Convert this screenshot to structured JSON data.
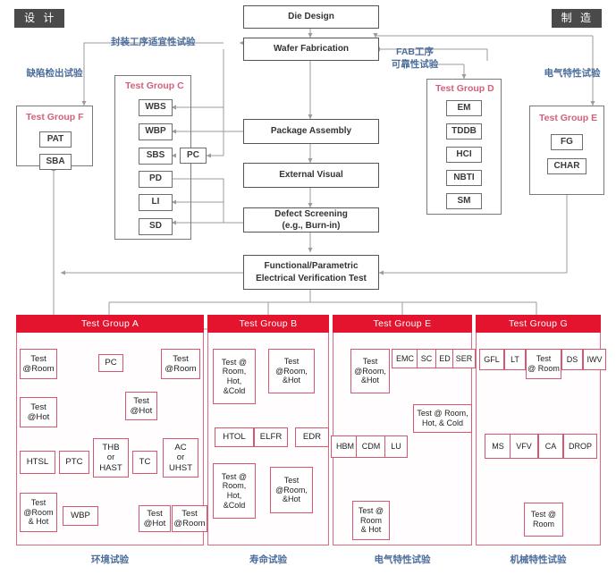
{
  "corner_tags": {
    "left": "设 计",
    "right": "制 造"
  },
  "flow_labels": {
    "package_suitability": "封装工序适宜性试验",
    "defect_detection": "缺陷检出试验",
    "fab_reliability": "FAB工序\n可靠性试验",
    "fab_reliability_line1": "FAB工序",
    "fab_reliability_line2": "可靠性试验",
    "electrical": "电气特性试验"
  },
  "process": {
    "die_design": "Die Design",
    "wafer_fabrication": "Wafer Fabrication",
    "package_assembly": "Package Assembly",
    "external_visual": "External Visual",
    "defect_screening_l1": "Defect Screening",
    "defect_screening_l2": "(e.g., Burn-in)",
    "functional_l1": "Functional/Parametric",
    "functional_l2": "Electrical Verification Test"
  },
  "group_c": {
    "title": "Test Group C",
    "items": [
      "WBS",
      "WBP",
      "SBS",
      "PD",
      "LI",
      "SD"
    ],
    "pc": "PC"
  },
  "group_f": {
    "title": "Test Group F",
    "items": [
      "PAT",
      "SBA"
    ]
  },
  "group_d": {
    "title": "Test Group D",
    "items": [
      "EM",
      "TDDB",
      "HCI",
      "NBTI",
      "SM"
    ]
  },
  "group_e_top": {
    "title": "Test Group E",
    "items": [
      "FG",
      "CHAR"
    ]
  },
  "bottom_groups": [
    {
      "title": "Test Group A",
      "footer": "环境试验",
      "nodes": [
        "Test\n@Room",
        "PC",
        "Test\n@Room",
        "Test\n@Hot",
        "Test\n@Hot",
        "HTSL",
        "PTC",
        "THB\nor\nHAST",
        "TC",
        "AC\nor\nUHST",
        "Test\n@Room\n& Hot",
        "WBP",
        "Test\n@Hot",
        "Test\n@Room"
      ]
    },
    {
      "title": "Test Group B",
      "footer": "寿命试验",
      "nodes": [
        "Test @\nRoom,\nHot,\n&Cold",
        "Test\n@Room,\n&Hot",
        "HTOL",
        "ELFR",
        "EDR",
        "Test @\nRoom,\nHot,\n&Cold",
        "Test\n@Room,\n&Hot"
      ]
    },
    {
      "title": "Test Group E",
      "footer": "电气特性试验",
      "nodes": [
        "Test\n@Room,\n&Hot",
        "EMC",
        "SC",
        "ED",
        "SER",
        "Test @ Room,\nHot, & Cold",
        "HBM",
        "CDM",
        "LU",
        "Test @\nRoom\n& Hot"
      ]
    },
    {
      "title": "Test Group G",
      "footer": "机械特性试验",
      "nodes": [
        "GFL",
        "LT",
        "Test\n@ Room",
        "DS",
        "IWV",
        "MS",
        "VFV",
        "CA",
        "DROP",
        "Test @\nRoom"
      ]
    }
  ],
  "group_a": {
    "title": "Test Group A",
    "footer": "环境试验",
    "test_room_1_l1": "Test",
    "test_room_1_l2": "@Room",
    "pc": "PC",
    "test_room_2_l1": "Test",
    "test_room_2_l2": "@Room",
    "test_hot_1_l1": "Test",
    "test_hot_1_l2": "@Hot",
    "test_hot_2_l1": "Test",
    "test_hot_2_l2": "@Hot",
    "htsl": "HTSL",
    "ptc": "PTC",
    "thb_l1": "THB",
    "thb_l2": "or",
    "thb_l3": "HAST",
    "tc": "TC",
    "ac_l1": "AC",
    "ac_l2": "or",
    "ac_l3": "UHST",
    "room_hot_l1": "Test",
    "room_hot_l2": "@Room",
    "room_hot_l3": "& Hot",
    "wbp": "WBP",
    "test_hot_3_l1": "Test",
    "test_hot_3_l2": "@Hot",
    "test_room_3_l1": "Test",
    "test_room_3_l2": "@Room"
  },
  "group_b": {
    "title": "Test Group B",
    "footer": "寿命试验",
    "n1_l1": "Test @",
    "n1_l2": "Room,",
    "n1_l3": "Hot,",
    "n1_l4": "&Cold",
    "n2_l1": "Test",
    "n2_l2": "@Room,",
    "n2_l3": "&Hot",
    "htol": "HTOL",
    "elfr": "ELFR",
    "edr": "EDR",
    "n3_l1": "Test @",
    "n3_l2": "Room,",
    "n3_l3": "Hot,",
    "n3_l4": "&Cold",
    "n4_l1": "Test",
    "n4_l2": "@Room,",
    "n4_l3": "&Hot"
  },
  "group_e": {
    "title": "Test Group E",
    "footer": "电气特性试验",
    "n1_l1": "Test",
    "n1_l2": "@Room,",
    "n1_l3": "&Hot",
    "emc": "EMC",
    "sc": "SC",
    "ed": "ED",
    "ser": "SER",
    "n2_l1": "Test @ Room,",
    "n2_l2": "Hot, & Cold",
    "hbm": "HBM",
    "cdm": "CDM",
    "lu": "LU",
    "n3_l1": "Test @",
    "n3_l2": "Room",
    "n3_l3": "& Hot"
  },
  "group_g": {
    "title": "Test Group G",
    "footer": "机械特性试验",
    "gfl": "GFL",
    "lt": "LT",
    "n1_l1": "Test",
    "n1_l2": "@ Room",
    "ds": "DS",
    "iwv": "IWV",
    "ms": "MS",
    "vfv": "VFV",
    "ca": "CA",
    "drop": "DROP",
    "n2_l1": "Test @",
    "n2_l2": "Room"
  },
  "colors": {
    "accent_red": "#e4142f",
    "pink_line": "#d5566e",
    "gray_line": "#9b9b9b",
    "blue_label": "#4b6d9b",
    "group_title": "#d4607a"
  }
}
